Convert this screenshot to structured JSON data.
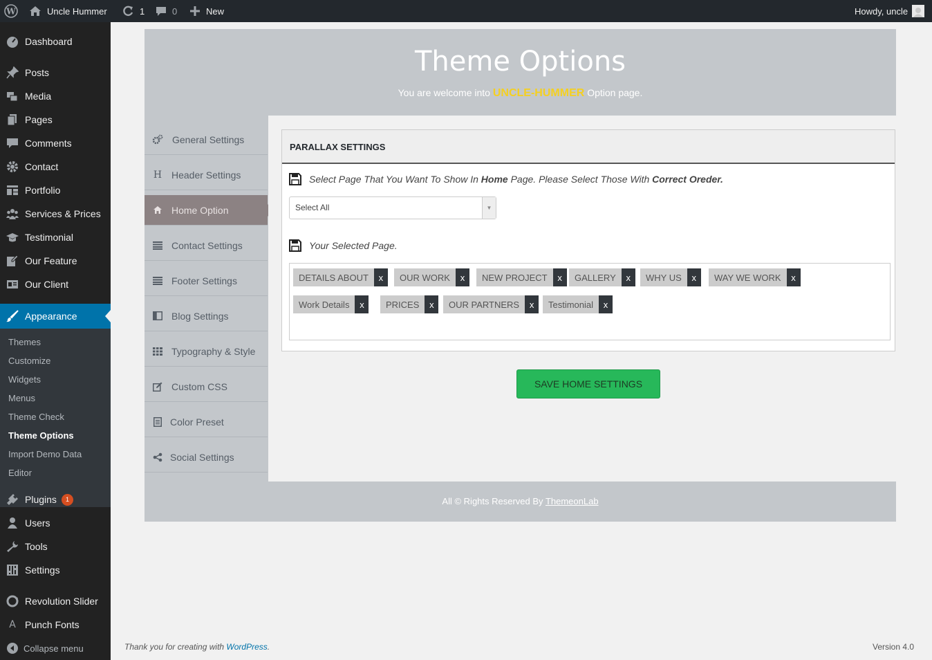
{
  "adminbar": {
    "site_name": "Uncle Hummer",
    "updates_count": "1",
    "comments_count": "0",
    "new_label": "New",
    "howdy": "Howdy, uncle"
  },
  "menu": {
    "dashboard": "Dashboard",
    "posts": "Posts",
    "media": "Media",
    "pages": "Pages",
    "comments": "Comments",
    "contact": "Contact",
    "portfolio": "Portfolio",
    "services": "Services & Prices",
    "testimonial": "Testimonial",
    "our_feature": "Our Feature",
    "our_client": "Our Client",
    "appearance": "Appearance",
    "plugins": "Plugins",
    "plugins_badge": "1",
    "users": "Users",
    "tools": "Tools",
    "settings": "Settings",
    "revolution_slider": "Revolution Slider",
    "punch_fonts": "Punch Fonts",
    "collapse": "Collapse menu"
  },
  "submenu": {
    "themes": "Themes",
    "customize": "Customize",
    "widgets": "Widgets",
    "menus": "Menus",
    "theme_check": "Theme Check",
    "theme_options": "Theme Options",
    "import_demo": "Import Demo Data",
    "editor": "Editor"
  },
  "panel": {
    "title": "Theme Options",
    "welcome_prefix": "You are welcome into",
    "brand": "UNCLE-HUMMER",
    "welcome_suffix": "Option page."
  },
  "tabs": {
    "general": "General Settings",
    "header": "Header Settings",
    "home": "Home Option",
    "contact": "Contact Settings",
    "footer": "Footer Settings",
    "blog": "Blog Settings",
    "typography": "Typography & Style",
    "css": "Custom CSS",
    "color": "Color Preset",
    "social": "Social Settings"
  },
  "parallax": {
    "heading": "PARALLAX SETTINGS",
    "instruction_a": "Select Page That You Want To Show In",
    "instruction_b": "Home",
    "instruction_c": "Page. Please Select Those With",
    "instruction_d": "Correct Oreder.",
    "select_value": "Select All",
    "selected_label": "Your Selected Page.",
    "chips": [
      "DETAILS ABOUT",
      "OUR WORK",
      "NEW PROJECT",
      "GALLERY",
      "WHY US",
      "WAY WE WORK",
      "Work Details",
      "PRICES",
      "OUR PARTNERS",
      "Testimonial"
    ],
    "remove_label": "x",
    "save_button": "SAVE HOME SETTINGS"
  },
  "rights": {
    "prefix": "All © Rights Reserved By",
    "link": "ThemeonLab"
  },
  "footer": {
    "thanks_prefix": "Thank you for creating with",
    "thanks_link": "WordPress",
    "thanks_suffix": ".",
    "version": "Version 4.0"
  }
}
